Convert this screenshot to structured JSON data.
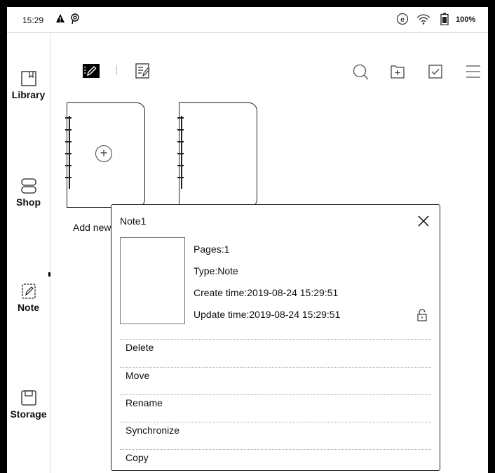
{
  "status_bar": {
    "time": "15:29",
    "battery_percent": "100%",
    "icons": [
      "alert-icon",
      "sync-status-icon",
      "network-icon",
      "wifi-icon",
      "battery-icon"
    ]
  },
  "sidebar": {
    "items": [
      {
        "label": "Library",
        "icon": "library-icon"
      },
      {
        "label": "Shop",
        "icon": "shop-icon"
      },
      {
        "label": "Note",
        "icon": "note-icon",
        "selected": true
      },
      {
        "label": "Storage",
        "icon": "storage-icon"
      }
    ]
  },
  "toolbar": {
    "icons": [
      "notes-view-icon",
      "documents-view-icon",
      "search-icon",
      "new-folder-icon",
      "select-icon",
      "menu-icon"
    ]
  },
  "notebooks": {
    "add_label": "Add new"
  },
  "popup": {
    "title": "Note1",
    "pages": "Pages:1",
    "type": "Type:Note",
    "create_time": "Create time:2019-08-24 15:29:51",
    "update_time": "Update time:2019-08-24 15:29:51",
    "menu": [
      "Delete",
      "Move",
      "Rename",
      "Synchronize",
      "Copy"
    ]
  }
}
